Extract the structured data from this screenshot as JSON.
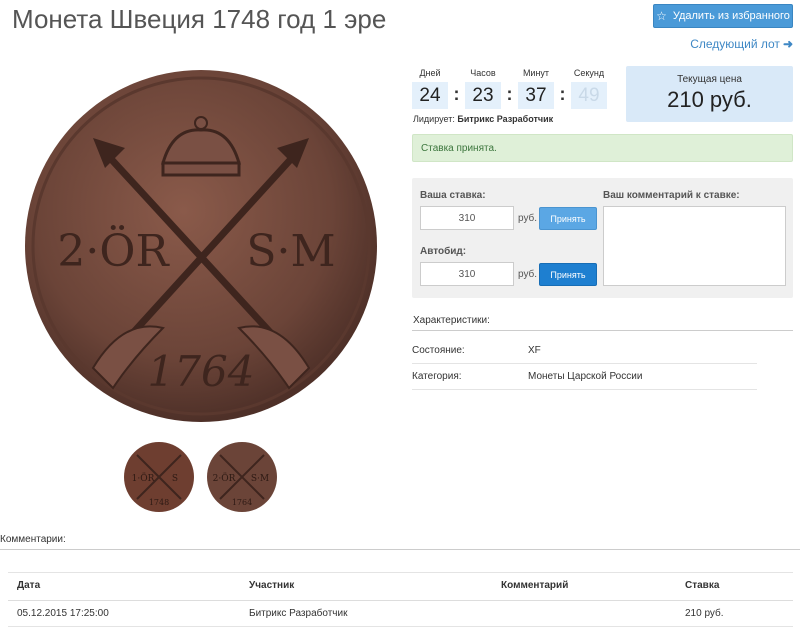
{
  "page": {
    "title": "Монета Швеция 1748 год 1 эре",
    "fav_button": "Удалить из избранного",
    "fav_icon": "star-outline-icon",
    "next_lot": "Следующий лот",
    "next_icon": "arrow-right-icon"
  },
  "images": {
    "main_coin_text": [
      "2·ÖR",
      "S·M",
      "1764"
    ],
    "thumb1_text": [
      "1·ÖR",
      "S",
      "1748"
    ],
    "thumb2_text": [
      "2·ÖR",
      "S·M",
      "1764"
    ]
  },
  "timer": {
    "labels": [
      "Дней",
      "Часов",
      "Минут",
      "Секунд"
    ],
    "values": [
      "24",
      "23",
      "37",
      "49"
    ],
    "separator": ":",
    "leader_label": "Лидирует:",
    "leader_name": "Битрикс Разработчик"
  },
  "price": {
    "label": "Текущая цена",
    "value": "210 руб."
  },
  "alert": {
    "text": "Ставка принята."
  },
  "bid": {
    "your_bid_label": "Ваша ставка:",
    "your_bid_value": "310",
    "unit": "руб.",
    "accept_label": "Принять",
    "autobid_label": "Автобид:",
    "autobid_value": "310",
    "comment_label": "Ваш комментарий к ставке:"
  },
  "characteristics": {
    "title": "Характеристики:",
    "rows": [
      {
        "key": "Состояние:",
        "value": "XF"
      },
      {
        "key": "Категория:",
        "value": "Монеты Царской России"
      }
    ]
  },
  "comments": {
    "title": "Комментарии:",
    "columns": [
      "Дата",
      "Участник",
      "Комментарий",
      "Ставка"
    ],
    "rows": [
      {
        "date": "05.12.2015 17:25:00",
        "user": "Битрикс Разработчик",
        "comment": "",
        "bid": "210 руб."
      }
    ]
  },
  "colors": {
    "primary": "#4a9ad8",
    "link": "#3f88c5",
    "success_bg": "#dff0d8",
    "price_bg": "#d9e9f8",
    "coin": "#6b4438"
  }
}
